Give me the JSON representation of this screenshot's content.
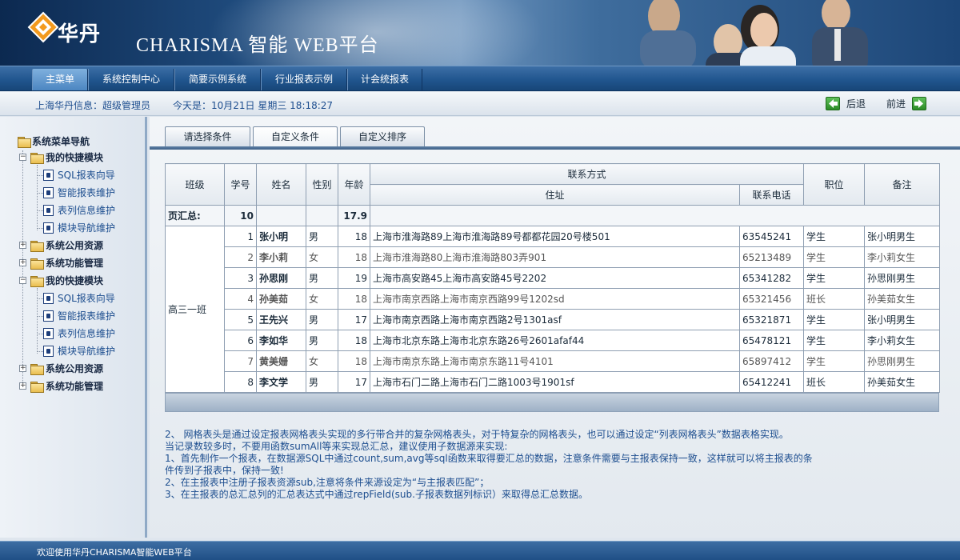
{
  "header": {
    "logo_text": "华丹",
    "platform_title": "CHARISMA 智能 WEB平台"
  },
  "nav": {
    "items": [
      {
        "label": "主菜单"
      },
      {
        "label": "系统控制中心"
      },
      {
        "label": "简要示例系统"
      },
      {
        "label": "行业报表示例"
      },
      {
        "label": "计会统报表"
      }
    ]
  },
  "infobar": {
    "user": "上海华丹信息：超级管理员",
    "date": "今天是：10月21日 星期三  18:18:27",
    "back_label": "后退",
    "forward_label": "前进"
  },
  "sidebar": {
    "root": "系统菜单导航",
    "groups": [
      {
        "label": "我的快捷模块",
        "items": [
          "SQL报表向导",
          "智能报表维护",
          "表列信息维护",
          "模块导航维护"
        ]
      },
      {
        "label": "系统公用资源"
      },
      {
        "label": "系统功能管理"
      },
      {
        "label": "我的快捷模块",
        "items": [
          "SQL报表向导",
          "智能报表维护",
          "表列信息维护",
          "模块导航维护"
        ]
      },
      {
        "label": "系统公用资源"
      },
      {
        "label": "系统功能管理"
      }
    ]
  },
  "tabs": [
    {
      "label": "请选择条件"
    },
    {
      "label": "自定义条件"
    },
    {
      "label": "自定义排序"
    }
  ],
  "table": {
    "headers": {
      "class": "班级",
      "no": "学号",
      "name": "姓名",
      "gender": "性别",
      "age": "年龄",
      "contact": "联系方式",
      "address": "住址",
      "phone": "联系电话",
      "position": "职位",
      "remark": "备注"
    },
    "summary": {
      "label": "页汇总:",
      "no": "10",
      "age": "17.9"
    },
    "group": "高三一班",
    "rows": [
      {
        "no": "1",
        "name": "张小明",
        "gender": "男",
        "age": "18",
        "address": "上海市淮海路89上海市淮海路89号都都花园20号楼501",
        "phone": "63545241",
        "position": "学生",
        "remark": "张小明男生"
      },
      {
        "no": "2",
        "name": "李小莉",
        "gender": "女",
        "age": "18",
        "address": "上海市淮海路80上海市淮海路803弄901",
        "phone": "65213489",
        "position": "学生",
        "remark": "李小莉女生"
      },
      {
        "no": "3",
        "name": "孙思刚",
        "gender": "男",
        "age": "19",
        "address": "上海市高安路45上海市高安路45号2202",
        "phone": "65341282",
        "position": "学生",
        "remark": "孙思刚男生"
      },
      {
        "no": "4",
        "name": "孙美茹",
        "gender": "女",
        "age": "18",
        "address": "上海市南京西路上海市南京西路99号1202sd",
        "phone": "65321456",
        "position": "班长",
        "remark": "孙美茹女生"
      },
      {
        "no": "5",
        "name": "王先兴",
        "gender": "男",
        "age": "17",
        "address": "上海市南京西路上海市南京西路2号1301asf",
        "phone": "65321871",
        "position": "学生",
        "remark": "张小明男生"
      },
      {
        "no": "6",
        "name": "李如华",
        "gender": "男",
        "age": "18",
        "address": "上海市北京东路上海市北京东路26号2601afaf44",
        "phone": "65478121",
        "position": "学生",
        "remark": "李小莉女生"
      },
      {
        "no": "7",
        "name": "黄美姗",
        "gender": "女",
        "age": "18",
        "address": "上海市南京东路上海市南京东路11号4101",
        "phone": "65897412",
        "position": "学生",
        "remark": "孙思刚男生"
      },
      {
        "no": "8",
        "name": "李文学",
        "gender": "男",
        "age": "17",
        "address": "上海市石门二路上海市石门二路1003号1901sf",
        "phone": "65412241",
        "position": "班长",
        "remark": "孙美茹女生"
      }
    ]
  },
  "notes": [
    "2、 网格表头是通过设定报表网格表头实现的多行带合并的复杂网格表头，对于特复杂的网格表头，也可以通过设定“列表网格表头”数据表格实现。",
    "    当记录数较多时，不要用函数sumAll等来实现总汇总，建议使用子数据源来实现:",
    "1、首先制作一个报表，在数据源SQL中通过count,sum,avg等sql函数来取得要汇总的数据，注意条件需要与主报表保持一致，这样就可以将主报表的条",
    "件传到子报表中，保持一致!",
    "2、在主报表中注册子报表资源sub,注意将条件来源设定为“与主报表匹配”；",
    "3、在主报表的总汇总列的汇总表达式中通过repField(sub.子报表数据列标识）来取得总汇总数据。"
  ],
  "footer": {
    "text": "欢迎使用华丹CHARISMA智能WEB平台"
  }
}
